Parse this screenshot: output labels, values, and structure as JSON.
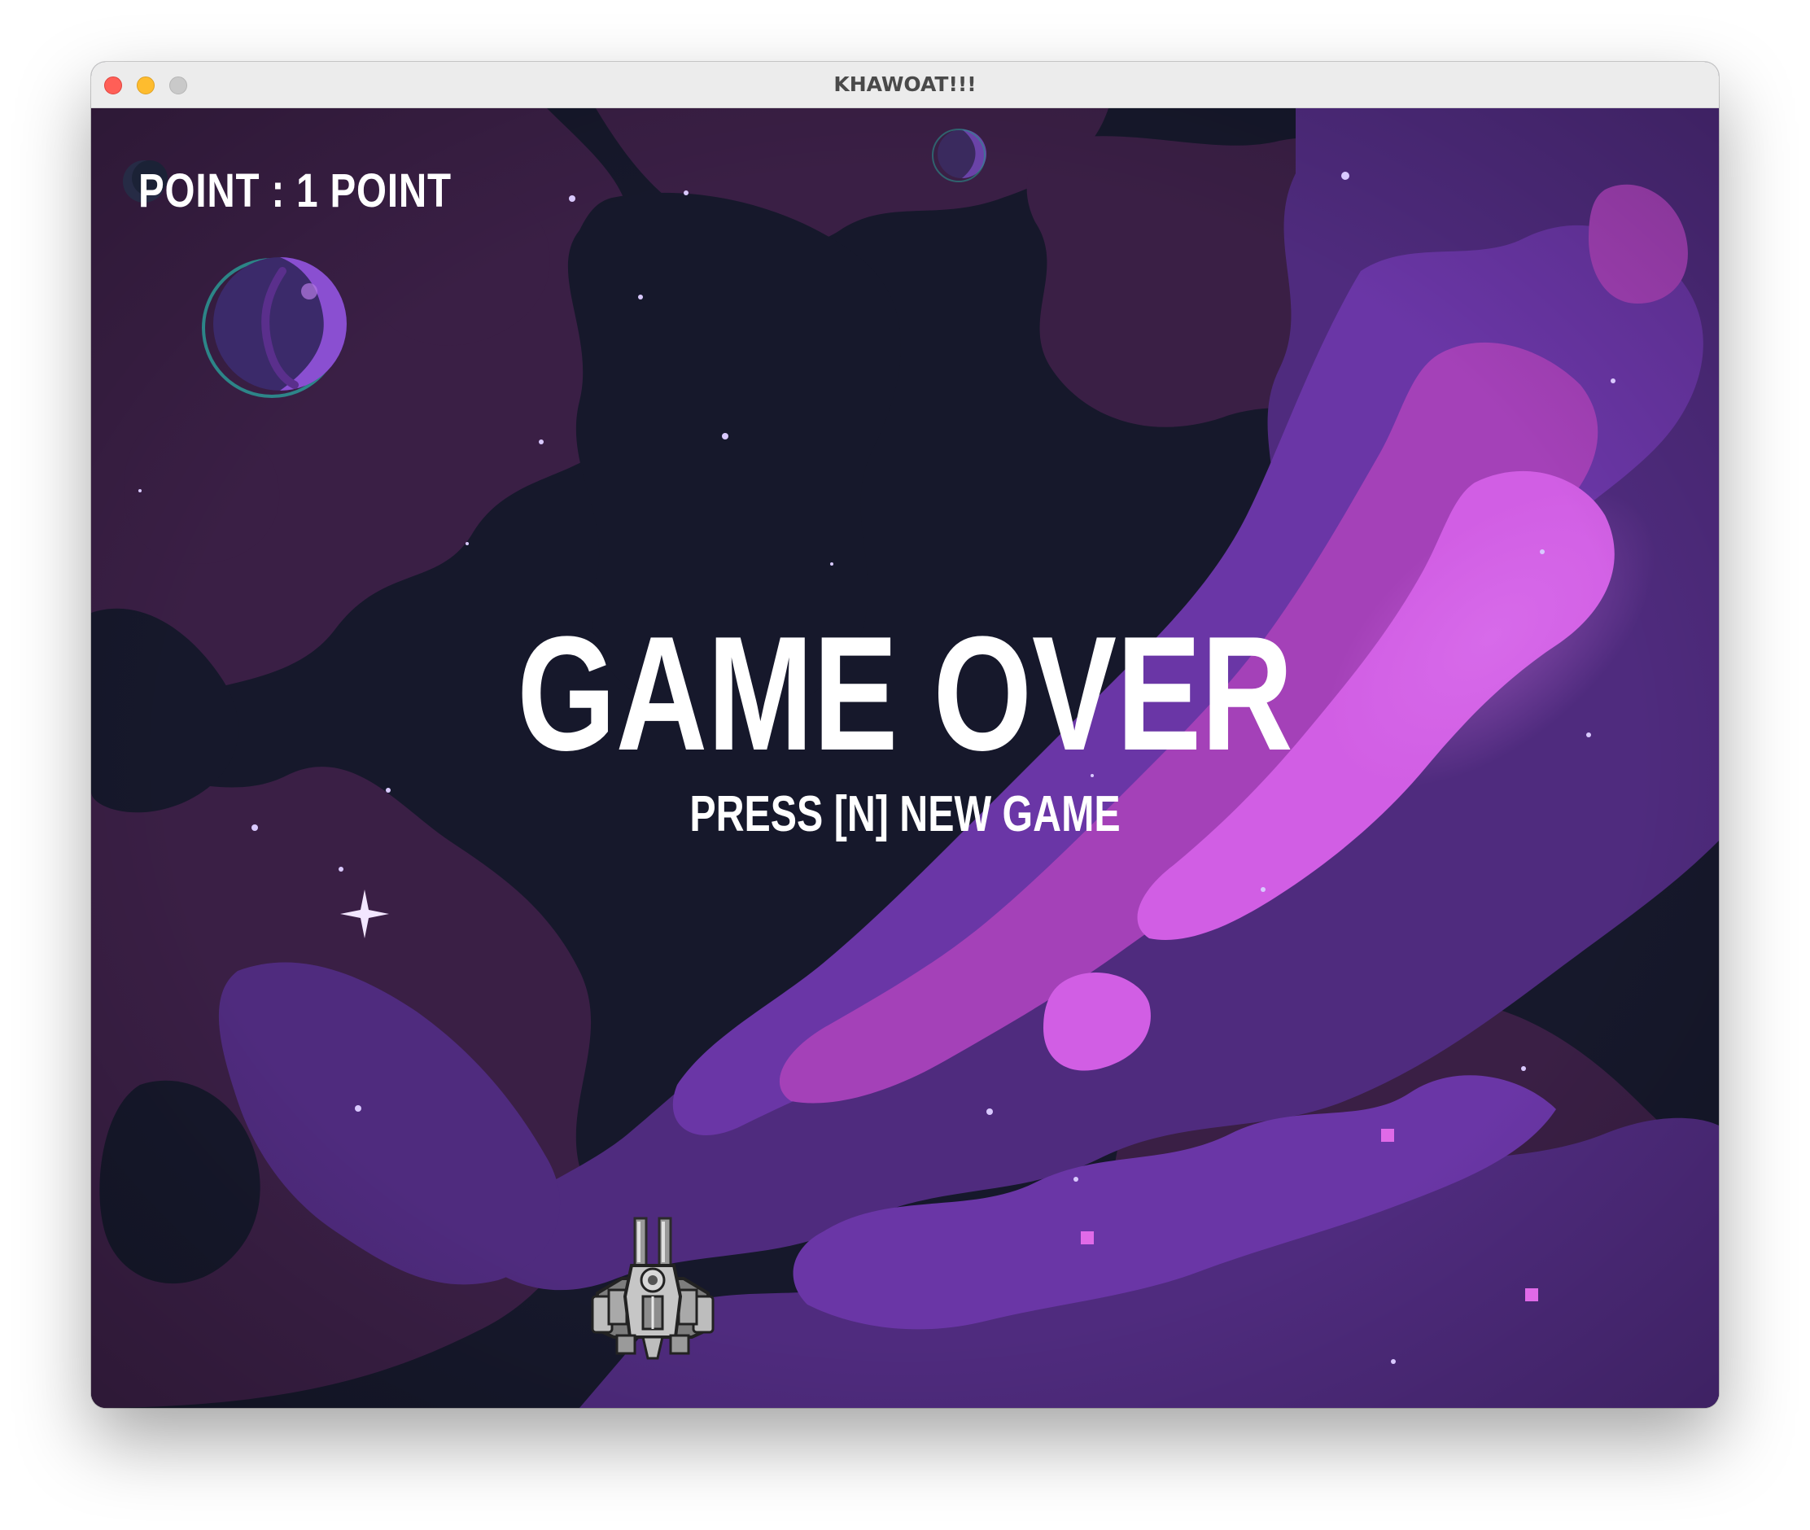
{
  "window": {
    "title": "KHAWOAT!!!"
  },
  "hud": {
    "score_text": "POINT : 1 POINT",
    "score": 1
  },
  "overlay": {
    "headline": "GAME OVER",
    "hint": "PRESS [N] NEW GAME"
  },
  "colors": {
    "space_dark": "#16182b",
    "nebula_plum": "#3a1f45",
    "nebula_violet": "#5a2f8c",
    "nebula_magenta": "#b049c4",
    "nebula_pink": "#d35fe6",
    "text": "#ffffff"
  },
  "sprites": {
    "player": "spaceship-icon",
    "planet": "planet-icon"
  }
}
